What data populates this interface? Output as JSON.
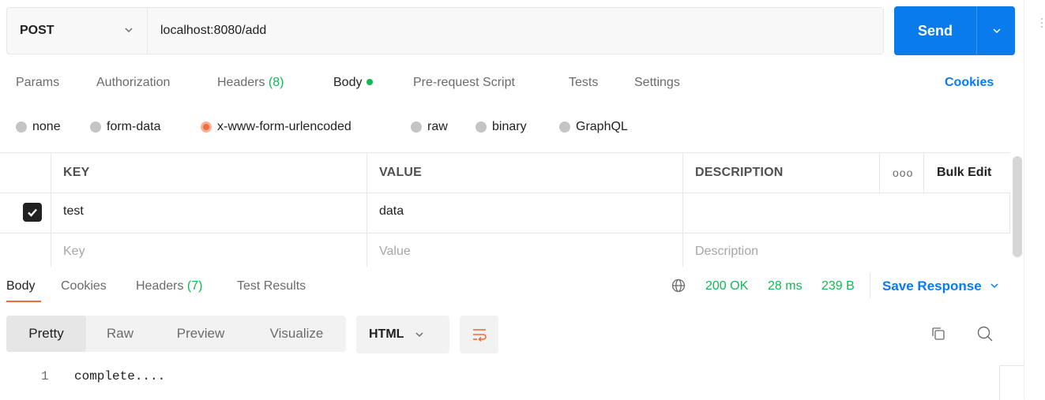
{
  "request": {
    "method": "POST",
    "url": "localhost:8080/add",
    "send_label": "Send"
  },
  "tabs": [
    {
      "label": "Params"
    },
    {
      "label": "Authorization"
    },
    {
      "label": "Headers ",
      "count": "(8)"
    },
    {
      "label": "Body",
      "active": true
    },
    {
      "label": "Pre-request Script"
    },
    {
      "label": "Tests"
    },
    {
      "label": "Settings"
    }
  ],
  "cookies_label": "Cookies",
  "body_types": [
    {
      "label": "none"
    },
    {
      "label": "form-data"
    },
    {
      "label": "x-www-form-urlencoded",
      "selected": true
    },
    {
      "label": "raw"
    },
    {
      "label": "binary"
    },
    {
      "label": "GraphQL"
    }
  ],
  "table": {
    "headers": {
      "key": "KEY",
      "value": "VALUE",
      "description": "DESCRIPTION",
      "more": "ooo",
      "bulk_edit": "Bulk Edit"
    },
    "rows": [
      {
        "checked": true,
        "key": "test",
        "value": "data",
        "description": ""
      }
    ],
    "placeholders": {
      "key": "Key",
      "value": "Value",
      "description": "Description"
    }
  },
  "response": {
    "tabs": [
      {
        "label": "Body",
        "active": true
      },
      {
        "label": "Cookies"
      },
      {
        "label": "Headers ",
        "count": "(7)"
      },
      {
        "label": "Test Results"
      }
    ],
    "status": "200 OK",
    "time": "28 ms",
    "size": "239 B",
    "save_label": "Save Response",
    "views": [
      {
        "label": "Pretty",
        "active": true
      },
      {
        "label": "Raw"
      },
      {
        "label": "Preview"
      },
      {
        "label": "Visualize"
      }
    ],
    "format": "HTML",
    "lines": [
      {
        "num": "1",
        "text": "complete...."
      }
    ]
  },
  "colors": {
    "accent": "#097bed",
    "success": "#0cbb52",
    "active_orange": "#f26b3a"
  }
}
